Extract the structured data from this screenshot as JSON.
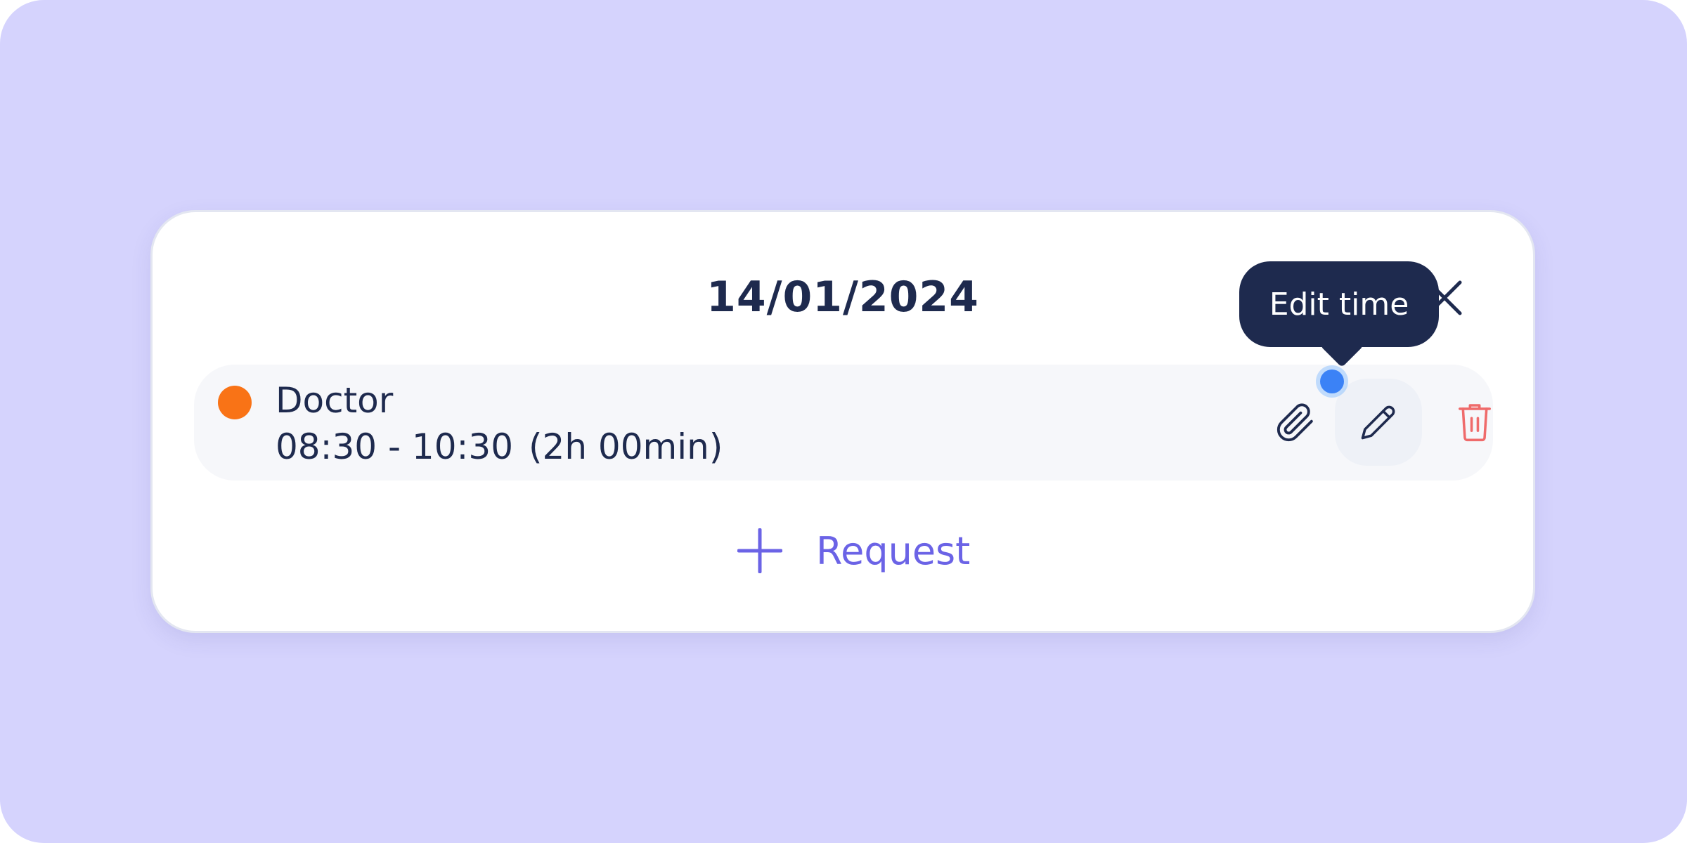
{
  "dialog": {
    "date": "14/01/2024",
    "close_icon": "close-icon"
  },
  "entry": {
    "type": "Doctor",
    "time_range": "08:30 - 10:30",
    "duration": "(2h 00min)",
    "status_color": "#f97316",
    "actions": {
      "attach_icon": "paperclip-icon",
      "edit_icon": "pencil-icon",
      "delete_icon": "trash-icon"
    }
  },
  "tooltip": {
    "text": "Edit time"
  },
  "request_button": {
    "icon": "plus-icon",
    "label": "Request"
  },
  "colors": {
    "background": "#d5d3fd",
    "text_primary": "#1e2a4e",
    "accent": "#6b63e6",
    "delete": "#ef6b6b",
    "cursor": "#3b82f6"
  }
}
